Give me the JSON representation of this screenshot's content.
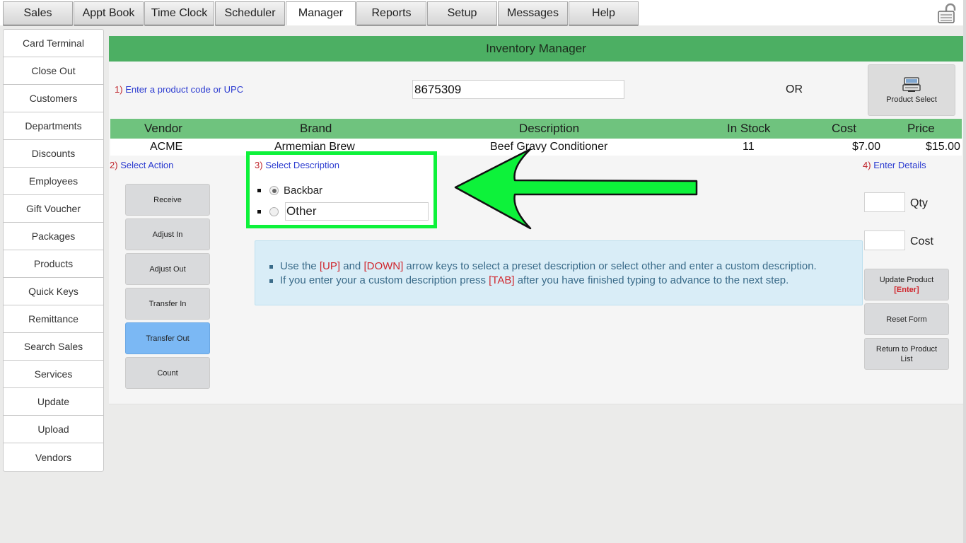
{
  "top_tabs": [
    {
      "label": "Sales"
    },
    {
      "label": "Appt Book"
    },
    {
      "label": "Time Clock"
    },
    {
      "label": "Scheduler"
    },
    {
      "label": "Manager",
      "active": true
    },
    {
      "label": "Reports"
    },
    {
      "label": "Setup"
    },
    {
      "label": "Messages"
    },
    {
      "label": "Help"
    }
  ],
  "sidebar": {
    "items": [
      {
        "label": "Card Terminal"
      },
      {
        "label": "Close Out"
      },
      {
        "label": "Customers"
      },
      {
        "label": "Departments"
      },
      {
        "label": "Discounts"
      },
      {
        "label": "Employees"
      },
      {
        "label": "Gift Voucher"
      },
      {
        "label": "Packages"
      },
      {
        "label": "Products"
      },
      {
        "label": "Quick Keys"
      },
      {
        "label": "Remittance"
      },
      {
        "label": "Search Sales"
      },
      {
        "label": "Services"
      },
      {
        "label": "Update"
      },
      {
        "label": "Upload"
      },
      {
        "label": "Vendors"
      }
    ]
  },
  "main": {
    "title": "Inventory Manager",
    "step1": {
      "num": "1)",
      "label": "Enter a product code or UPC"
    },
    "code_value": "8675309",
    "or_label": "OR",
    "product_select_label": "Product Select",
    "table": {
      "headers": [
        "Vendor",
        "Brand",
        "Description",
        "In Stock",
        "Cost",
        "Price"
      ],
      "row": [
        "ACME",
        "Armemian Brew",
        "Beef Gravy Conditioner",
        "11",
        "$7.00",
        "$15.00"
      ]
    },
    "step2": {
      "num": "2)",
      "label": "Select Action"
    },
    "actions": [
      {
        "label": "Receive"
      },
      {
        "label": "Adjust In"
      },
      {
        "label": "Adjust Out"
      },
      {
        "label": "Transfer In"
      },
      {
        "label": "Transfer Out",
        "selected": true
      },
      {
        "label": "Count"
      }
    ],
    "step3": {
      "num": "3)",
      "label": "Select Description"
    },
    "desc_options": {
      "backbar": "Backbar",
      "other_value": "Other"
    },
    "info": {
      "line1": {
        "a": "Use the ",
        "k1": "[UP]",
        "b": " and ",
        "k2": "[DOWN]",
        "c": " arrow keys to select a preset description or select other and enter a custom description."
      },
      "line2": {
        "a": "If you enter your a custom description press ",
        "k1": "[TAB]",
        "b": " after you have finished typing to advance to the next step."
      }
    },
    "step4": {
      "num": "4)",
      "label": "Enter Details"
    },
    "qty_label": "Qty",
    "cost_label": "Cost",
    "buttons": {
      "update": "Update Product",
      "update_hint": "[Enter]",
      "reset": "Reset Form",
      "return": "Return to Product List"
    }
  },
  "colors": {
    "title_bar": "#4caf63",
    "table_head": "#6fc37e",
    "highlight_box": "#0df23a",
    "selected_action": "#7bb8f4",
    "info_bg": "#d9edf7",
    "step_number": "#c0262d",
    "step_text": "#2a3ad0"
  },
  "icons": {
    "lock": "unlock-icon",
    "product_select": "register-icon",
    "annotation": "green-arrow-icon"
  }
}
